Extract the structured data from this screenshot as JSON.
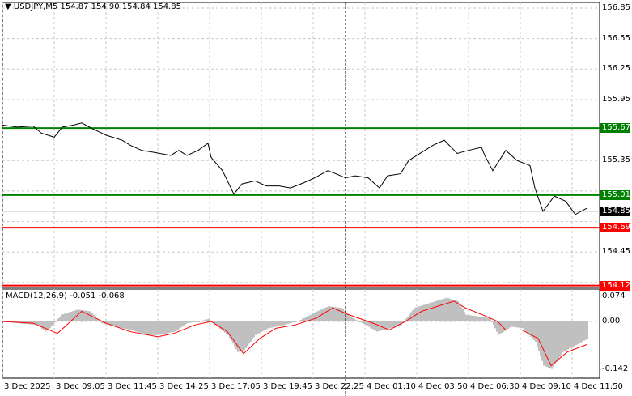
{
  "header": {
    "symbol": "USDJPY,M5",
    "ohlc": "154.87 154.90 154.84 154.85"
  },
  "price_axis": [
    "156.85",
    "156.55",
    "156.25",
    "155.95",
    "155.35",
    "154.45"
  ],
  "levels": [
    {
      "label": "155.67",
      "value": 155.67,
      "color": "#008000"
    },
    {
      "label": "155.01",
      "value": 155.01,
      "color": "#008000"
    },
    {
      "label": "154.69",
      "value": 154.69,
      "color": "#ff0000"
    },
    {
      "label": "154.12",
      "value": 154.12,
      "color": "#ff0000"
    }
  ],
  "current_price": {
    "label": "154.85",
    "value": 154.85
  },
  "macd": {
    "title": "MACD(12,26,9) -0.051 -0.068",
    "axis": [
      "0.074",
      "0.00",
      "-0.142"
    ]
  },
  "time_axis": [
    "3 Dec 2025",
    "3 Dec 09:05",
    "3 Dec 11:45",
    "3 Dec 14:25",
    "3 Dec 17:05",
    "3 Dec 19:45",
    "3 Dec 22:25",
    "4 Dec 01:10",
    "4 Dec 03:50",
    "4 Dec 06:30",
    "4 Dec 09:10",
    "4 Dec 11:50"
  ],
  "colors": {
    "support_resistance_green": "#008000",
    "red_level": "#ff0000",
    "histogram": "#c0c0c0",
    "signal": "#ff0000"
  },
  "chart_data": {
    "type": "line",
    "price_series": [
      [
        0,
        155.7
      ],
      [
        9,
        155.68
      ],
      [
        19,
        155.69
      ],
      [
        24,
        155.62
      ],
      [
        32,
        155.58
      ],
      [
        37,
        155.68
      ],
      [
        44,
        155.7
      ],
      [
        49,
        155.72
      ],
      [
        56,
        155.66
      ],
      [
        64,
        155.6
      ],
      [
        74,
        155.55
      ],
      [
        79,
        155.5
      ],
      [
        86,
        155.45
      ],
      [
        94,
        155.43
      ],
      [
        104,
        155.4
      ],
      [
        109,
        155.45
      ],
      [
        114,
        155.4
      ],
      [
        121,
        155.45
      ],
      [
        127,
        155.52
      ],
      [
        129,
        155.38
      ],
      [
        136,
        155.25
      ],
      [
        143,
        155.02
      ],
      [
        148,
        155.12
      ],
      [
        156,
        155.15
      ],
      [
        163,
        155.1
      ],
      [
        171,
        155.1
      ],
      [
        178,
        155.08
      ],
      [
        186,
        155.13
      ],
      [
        193,
        155.18
      ],
      [
        201,
        155.25
      ],
      [
        206,
        155.22
      ],
      [
        212,
        155.18
      ],
      [
        218,
        155.2
      ],
      [
        226,
        155.18
      ],
      [
        233,
        155.08
      ],
      [
        238,
        155.2
      ],
      [
        246,
        155.22
      ],
      [
        251,
        155.35
      ],
      [
        258,
        155.42
      ],
      [
        266,
        155.5
      ],
      [
        273,
        155.55
      ],
      [
        281,
        155.42
      ],
      [
        288,
        155.45
      ],
      [
        296,
        155.48
      ],
      [
        298,
        155.4
      ],
      [
        303,
        155.25
      ],
      [
        311,
        155.45
      ],
      [
        318,
        155.35
      ],
      [
        326,
        155.3
      ],
      [
        329,
        155.08
      ],
      [
        334,
        154.85
      ],
      [
        341,
        155.0
      ],
      [
        348,
        154.95
      ],
      [
        354,
        154.82
      ],
      [
        361,
        154.88
      ]
    ],
    "macd_histogram": [
      [
        0,
        0.0
      ],
      [
        9,
        -0.005
      ],
      [
        21,
        -0.01
      ],
      [
        26,
        -0.03
      ],
      [
        29,
        -0.02
      ],
      [
        36,
        0.02
      ],
      [
        46,
        0.035
      ],
      [
        54,
        0.03
      ],
      [
        61,
        -0.005
      ],
      [
        69,
        -0.015
      ],
      [
        79,
        -0.025
      ],
      [
        89,
        -0.04
      ],
      [
        96,
        -0.04
      ],
      [
        106,
        -0.03
      ],
      [
        114,
        -0.005
      ],
      [
        121,
        0.0
      ],
      [
        127,
        0.008
      ],
      [
        131,
        -0.01
      ],
      [
        139,
        -0.04
      ],
      [
        145,
        -0.09
      ],
      [
        149,
        -0.085
      ],
      [
        156,
        -0.04
      ],
      [
        164,
        -0.02
      ],
      [
        174,
        -0.01
      ],
      [
        184,
        0.005
      ],
      [
        194,
        0.03
      ],
      [
        201,
        0.045
      ],
      [
        209,
        0.04
      ],
      [
        216,
        0.01
      ],
      [
        224,
        -0.01
      ],
      [
        231,
        -0.03
      ],
      [
        239,
        -0.02
      ],
      [
        246,
        -0.01
      ],
      [
        254,
        0.04
      ],
      [
        264,
        0.055
      ],
      [
        274,
        0.07
      ],
      [
        281,
        0.06
      ],
      [
        286,
        0.02
      ],
      [
        294,
        0.015
      ],
      [
        301,
        0.01
      ],
      [
        306,
        -0.04
      ],
      [
        314,
        -0.015
      ],
      [
        321,
        -0.02
      ],
      [
        329,
        -0.06
      ],
      [
        334,
        -0.13
      ],
      [
        339,
        -0.14
      ],
      [
        346,
        -0.09
      ],
      [
        354,
        -0.07
      ],
      [
        361,
        -0.051
      ]
    ],
    "macd_signal": [
      [
        0,
        0.0
      ],
      [
        19,
        -0.005
      ],
      [
        34,
        -0.035
      ],
      [
        49,
        0.03
      ],
      [
        64,
        -0.005
      ],
      [
        79,
        -0.03
      ],
      [
        96,
        -0.045
      ],
      [
        106,
        -0.035
      ],
      [
        119,
        -0.01
      ],
      [
        129,
        0.0
      ],
      [
        139,
        -0.03
      ],
      [
        149,
        -0.095
      ],
      [
        159,
        -0.05
      ],
      [
        169,
        -0.02
      ],
      [
        181,
        -0.01
      ],
      [
        194,
        0.01
      ],
      [
        204,
        0.04
      ],
      [
        214,
        0.02
      ],
      [
        229,
        -0.005
      ],
      [
        239,
        -0.025
      ],
      [
        249,
        0.0
      ],
      [
        259,
        0.03
      ],
      [
        279,
        0.06
      ],
      [
        286,
        0.04
      ],
      [
        299,
        0.015
      ],
      [
        306,
        0.0
      ],
      [
        311,
        -0.025
      ],
      [
        321,
        -0.025
      ],
      [
        331,
        -0.05
      ],
      [
        339,
        -0.13
      ],
      [
        349,
        -0.09
      ],
      [
        361,
        -0.068
      ]
    ]
  }
}
